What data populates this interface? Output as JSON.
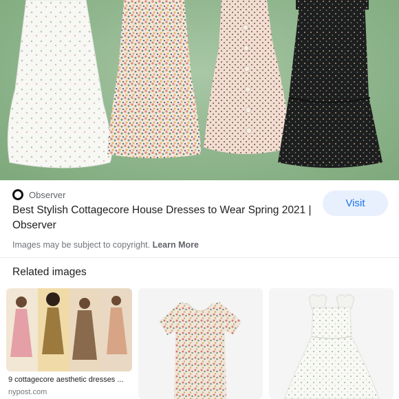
{
  "result": {
    "source_name": "Observer",
    "title": "Best Stylish Cottagecore House Dresses to Wear Spring 2021 | Observer",
    "visit_label": "Visit",
    "copyright_text": "Images may be subject to copyright.",
    "learn_more_label": "Learn More"
  },
  "related": {
    "heading": "Related images",
    "items": [
      {
        "caption": "9 cottagecore aesthetic dresses ...",
        "source": "nypost.com"
      },
      {
        "caption": "",
        "source": ""
      },
      {
        "caption": "",
        "source": ""
      }
    ]
  },
  "colors": {
    "hero_background": "#8fb58d",
    "visit_button_bg": "#e8f0fe",
    "visit_button_text": "#1a73e8"
  }
}
